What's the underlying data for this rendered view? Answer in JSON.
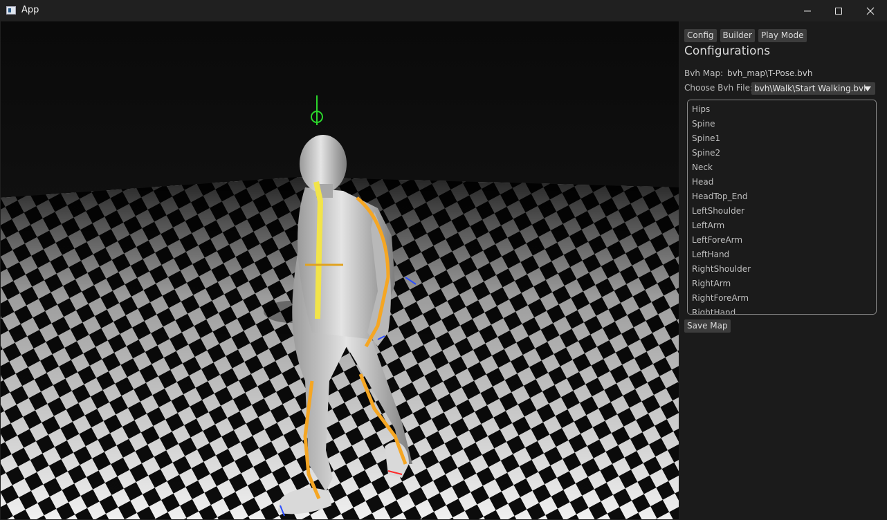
{
  "window": {
    "title": "App"
  },
  "colors": {
    "accent_orange": "#f5a623",
    "accent_yellow": "#f2e44a",
    "panel_bg": "#1b1b1b",
    "button_bg": "#3c3c3c"
  },
  "panel": {
    "tabs": [
      "Config",
      "Builder",
      "Play Mode"
    ],
    "heading": "Configurations",
    "bvh_map_label": "Bvh Map:",
    "bvh_map_value": "bvh_map\\T-Pose.bvh",
    "choose_label": "Choose Bvh File:",
    "choose_value": "bvh\\Walk\\Start Walking.bvh",
    "bones": [
      "Hips",
      "Spine",
      "Spine1",
      "Spine2",
      "Neck",
      "Head",
      "HeadTop_End",
      "LeftShoulder",
      "LeftArm",
      "LeftForeArm",
      "LeftHand",
      "RightShoulder",
      "RightArm",
      "RightForeArm",
      "RightHand"
    ],
    "save_label": "Save Map"
  }
}
